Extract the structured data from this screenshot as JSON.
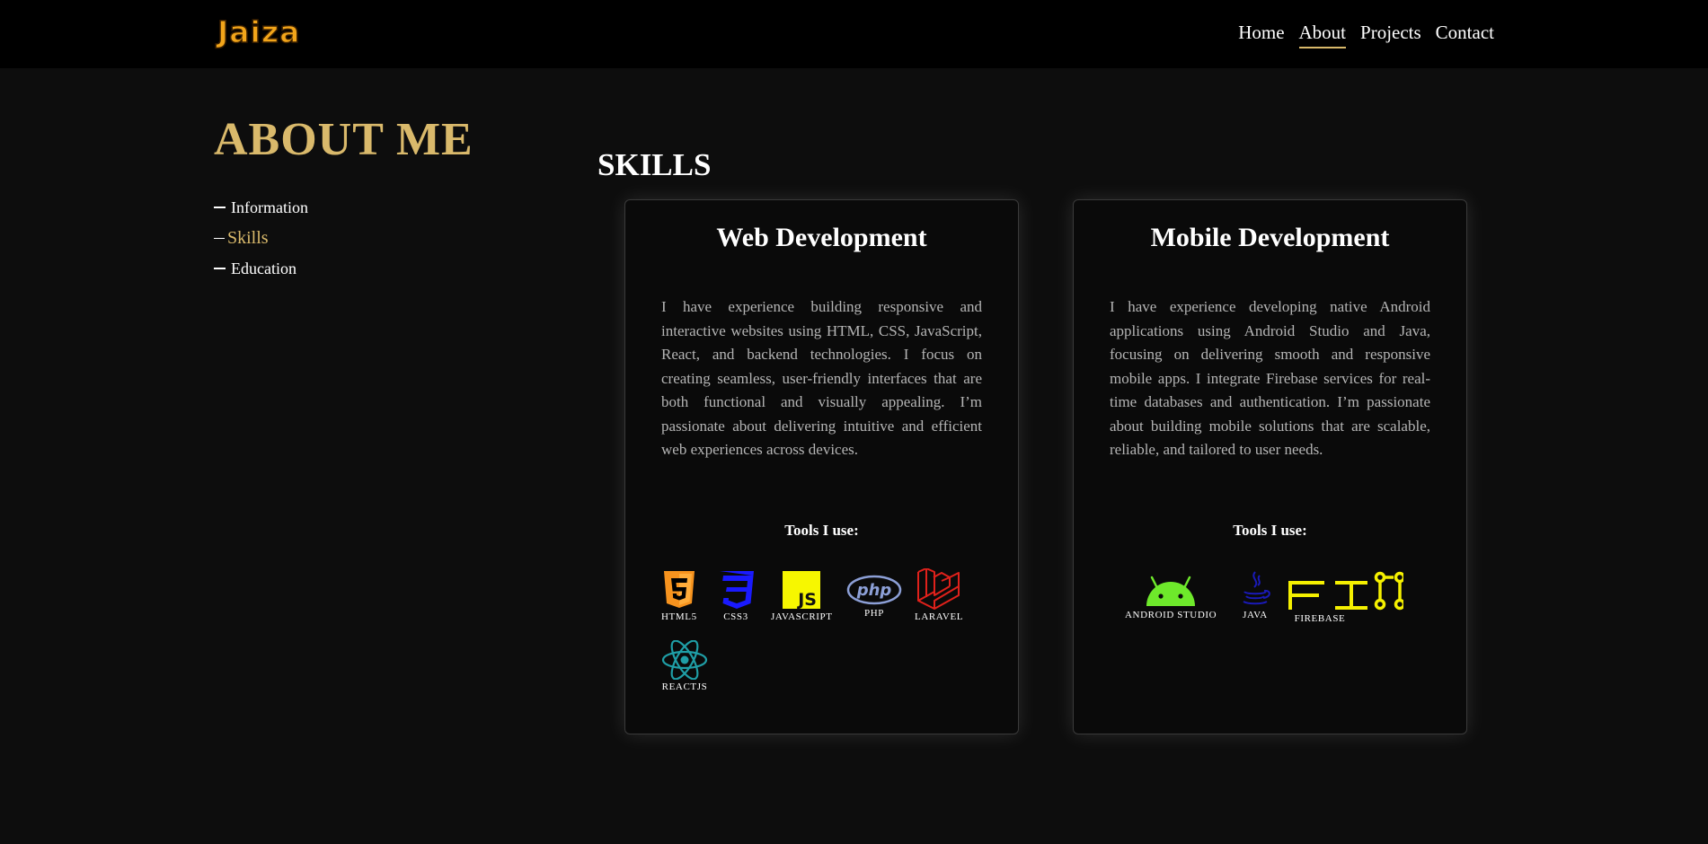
{
  "nav": {
    "logo": "Jaiza",
    "links": [
      "Home",
      "About",
      "Projects",
      "Contact"
    ],
    "active": "About"
  },
  "about": {
    "title": "ABOUT ME",
    "sections": [
      "Information",
      "Skills",
      "Education"
    ],
    "active_section": "Skills"
  },
  "skills": {
    "title": "SKILLS",
    "cards": [
      {
        "title": "Web Development",
        "text": "I have experience building responsive and interactive websites using HTML, CSS, JavaScript, React, and backend technologies. I focus on creating seamless, user-friendly interfaces that are both functional and visually appealing. I’m passionate about delivering intuitive and efficient web experiences across devices.",
        "tools_label": "Tools I use:",
        "tools": [
          {
            "name": "HTML5",
            "icon": "html5-icon",
            "color": "#f7931e"
          },
          {
            "name": "CSS3",
            "icon": "css3-icon",
            "color": "#1a1aff"
          },
          {
            "name": "JAVASCRIPT",
            "icon": "javascript-icon",
            "color": "#f7f700"
          },
          {
            "name": "PHP",
            "icon": "php-icon",
            "color": "#8c9fd6"
          },
          {
            "name": "LARAVEL",
            "icon": "laravel-icon",
            "color": "#e0211b"
          },
          {
            "name": "REACTJS",
            "icon": "react-icon",
            "color": "#1f9ea6"
          }
        ]
      },
      {
        "title": "Mobile Development",
        "text": "I have experience developing native Android applications using Android Studio and Java, focusing on delivering smooth and responsive mobile apps. I integrate Firebase services for real-time databases and authentication. I’m passionate about building mobile solutions that are scalable, reliable, and tailored to user needs.",
        "tools_label": "Tools I use:",
        "tools": [
          {
            "name": "ANDROID STUDIO",
            "icon": "android-icon",
            "color": "#6ee92b"
          },
          {
            "name": "JAVA",
            "icon": "java-icon",
            "color": "#1a1ab8"
          },
          {
            "name": "FIREBASE",
            "icon": "firebase-icon",
            "color": "#f5f000"
          }
        ]
      }
    ]
  },
  "colors": {
    "accent": "#d9b96b",
    "background": "#0d0d0d",
    "navbar": "#000000",
    "card_border": "#3a3a3a",
    "body_text": "#b5b5b5"
  }
}
